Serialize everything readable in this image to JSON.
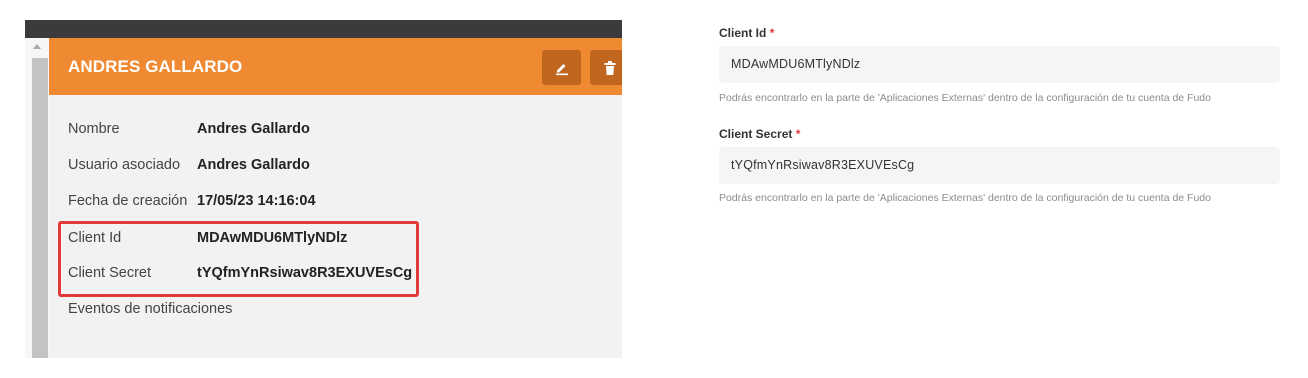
{
  "card": {
    "title": "ANDRES GALLARDO",
    "rows": [
      {
        "label": "Nombre",
        "value": "Andres Gallardo"
      },
      {
        "label": "Usuario asociado",
        "value": "Andres Gallardo"
      },
      {
        "label": "Fecha de creación",
        "value": "17/05/23 14:16:04"
      },
      {
        "label": "Client Id",
        "value": "MDAwMDU6MTlyNDlz"
      },
      {
        "label": "Client Secret",
        "value": "tYQfmYnRsiwav8R3EXUVEsCg"
      },
      {
        "label": "Eventos de notificaciones"
      }
    ]
  },
  "form": {
    "client_id": {
      "label": "Client Id",
      "required_mark": "*",
      "value": "MDAwMDU6MTlyNDlz",
      "helper": "Podrás encontrarlo en la parte de 'Aplicaciones Externas' dentro de la configuración de tu cuenta de Fudo"
    },
    "client_secret": {
      "label": "Client Secret",
      "required_mark": "*",
      "value": "tYQfmYnRsiwav8R3EXUVEsCg",
      "helper": "Podrás encontrarlo en la parte de 'Aplicaciones Externas' dentro de la configuración de tu cuenta de Fudo"
    }
  },
  "colors": {
    "header": "#f08a32",
    "header_button": "#c0661f",
    "highlight": "#e03a3a",
    "panel_bg": "#f2f2f2"
  },
  "icons": [
    "edit-icon",
    "trash-icon"
  ]
}
